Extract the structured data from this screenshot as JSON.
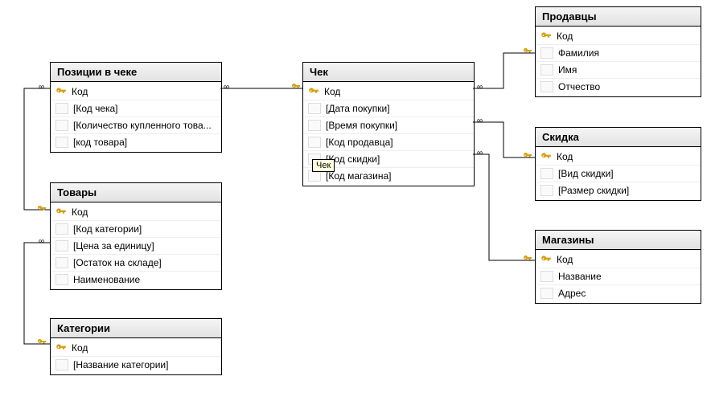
{
  "tooltip": "Чек",
  "tables": {
    "positions": {
      "title": "Позиции в чеке",
      "fields": [
        {
          "pk": true,
          "label": "Код"
        },
        {
          "pk": false,
          "label": "[Код чека]"
        },
        {
          "pk": false,
          "label": "[Количество купленного това..."
        },
        {
          "pk": false,
          "label": "[код товара]"
        }
      ]
    },
    "goods": {
      "title": "Товары",
      "fields": [
        {
          "pk": true,
          "label": "Код"
        },
        {
          "pk": false,
          "label": "[Код категории]"
        },
        {
          "pk": false,
          "label": "[Цена за единицу]"
        },
        {
          "pk": false,
          "label": "[Остаток на складе]"
        },
        {
          "pk": false,
          "label": "Наименование"
        }
      ]
    },
    "categories": {
      "title": "Категории",
      "fields": [
        {
          "pk": true,
          "label": "Код"
        },
        {
          "pk": false,
          "label": "[Название категории]"
        }
      ]
    },
    "receipt": {
      "title": "Чек",
      "fields": [
        {
          "pk": true,
          "label": "Код"
        },
        {
          "pk": false,
          "label": "[Дата покупки]"
        },
        {
          "pk": false,
          "label": "[Время покупки]"
        },
        {
          "pk": false,
          "label": "[Код продавца]"
        },
        {
          "pk": false,
          "label": "[Код скидки]"
        },
        {
          "pk": false,
          "label": "[Код магазина]"
        }
      ]
    },
    "sellers": {
      "title": "Продавцы",
      "fields": [
        {
          "pk": true,
          "label": "Код"
        },
        {
          "pk": false,
          "label": "Фамилия"
        },
        {
          "pk": false,
          "label": "Имя"
        },
        {
          "pk": false,
          "label": "Отчество"
        }
      ]
    },
    "discount": {
      "title": "Скидка",
      "fields": [
        {
          "pk": true,
          "label": "Код"
        },
        {
          "pk": false,
          "label": "[Вид скидки]"
        },
        {
          "pk": false,
          "label": "[Размер скидки]"
        }
      ]
    },
    "stores": {
      "title": "Магазины",
      "fields": [
        {
          "pk": true,
          "label": "Код"
        },
        {
          "pk": false,
          "label": "Название"
        },
        {
          "pk": false,
          "label": "Адрес"
        }
      ]
    }
  }
}
